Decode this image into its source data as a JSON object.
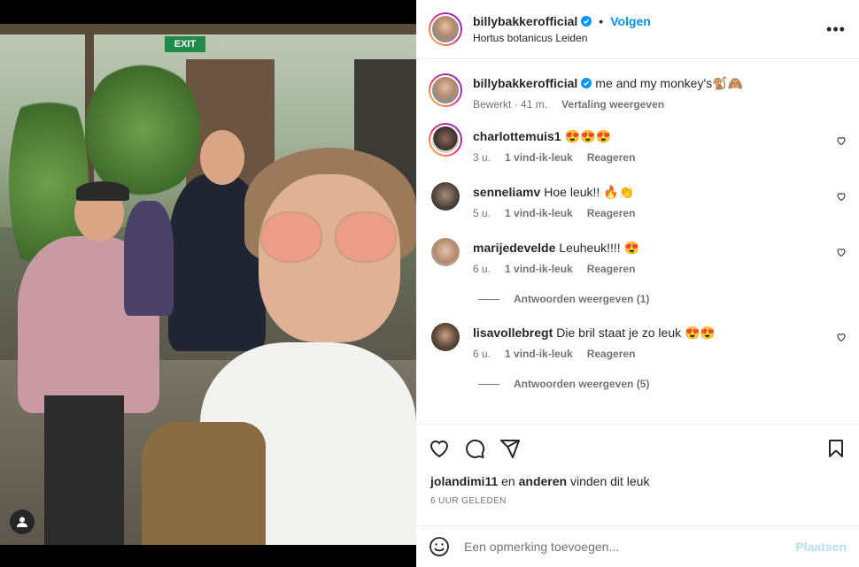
{
  "post": {
    "author": "billybakkerofficial",
    "follow_label": "Volgen",
    "location": "Hortus botanicus Leiden",
    "caption": "me and my monkey's🐒🙈",
    "caption_meta": {
      "edited": "Bewerkt",
      "time": "41 m.",
      "translate": "Vertaling weergeven"
    },
    "image": {
      "exit_sign": "EXIT"
    }
  },
  "comments": [
    {
      "user": "charlottemuis1",
      "text": "😍😍😍",
      "time": "3 u.",
      "likes": "1 vind-ik-leuk",
      "reply": "Reageren"
    },
    {
      "user": "senneliamv",
      "text": "Hoe leuk!! 🔥👏",
      "time": "5 u.",
      "likes": "1 vind-ik-leuk",
      "reply": "Reageren"
    },
    {
      "user": "marijedevelde",
      "text": "Leuheuk!!!! 😍",
      "time": "6 u.",
      "likes": "1 vind-ik-leuk",
      "reply": "Reageren",
      "view_replies": "Antwoorden weergeven (1)"
    },
    {
      "user": "lisavollebregt",
      "text": "Die bril staat je zo leuk 😍😍",
      "time": "6 u.",
      "likes": "1 vind-ik-leuk",
      "reply": "Reageren",
      "view_replies": "Antwoorden weergeven (5)"
    }
  ],
  "likes_line": {
    "user": "jolandimi11",
    "connector": "en",
    "others": "anderen",
    "suffix": "vinden dit leuk"
  },
  "posted_ago": "6 UUR GELEDEN",
  "add_comment": {
    "placeholder": "Een opmerking toevoegen...",
    "post_label": "Plaatsen"
  },
  "colors": {
    "accent": "#0095f6",
    "muted": "#737373",
    "post_disabled": "#b2dffc"
  },
  "icons": [
    "more-icon",
    "verified-icon",
    "heart-icon",
    "comment-icon",
    "share-icon",
    "bookmark-icon",
    "emoji-icon",
    "user-tag-icon"
  ]
}
